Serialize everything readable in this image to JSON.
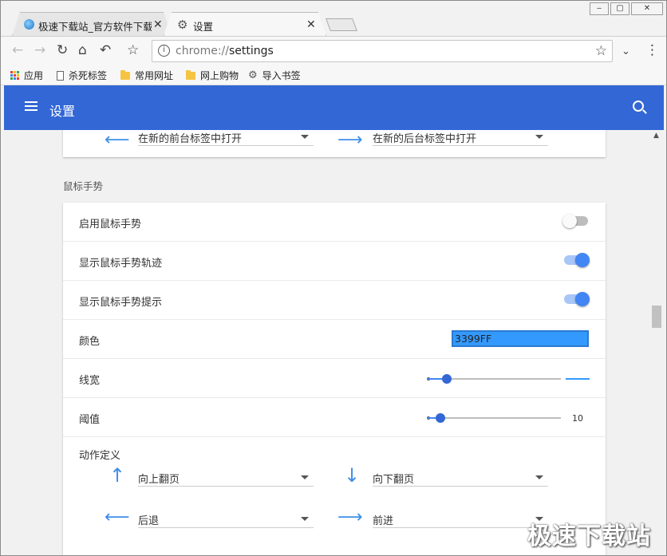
{
  "window": {
    "controls": [
      "‒",
      "▢",
      "✕"
    ]
  },
  "tabs": [
    {
      "label": "极速下载站_官方软件下载",
      "active": false
    },
    {
      "label": "设置",
      "active": true
    }
  ],
  "toolbar": {
    "url_scheme": "chrome://",
    "url_path": "settings"
  },
  "bookmarks": [
    {
      "label": "应用",
      "icon": "apps-grid-icon"
    },
    {
      "label": "杀死标签",
      "icon": "page-icon"
    },
    {
      "label": "常用网址",
      "icon": "folder-icon"
    },
    {
      "label": "网上购物",
      "icon": "folder-icon"
    },
    {
      "label": "导入书签",
      "icon": "gear-icon"
    }
  ],
  "header": {
    "title": "设置"
  },
  "top_card": {
    "left_action": "在新的前台标签中打开",
    "right_action": "在新的后台标签中打开"
  },
  "mouse_gesture": {
    "section_title": "鼠标手势",
    "enable_label": "启用鼠标手势",
    "enable_on": false,
    "show_trail_label": "显示鼠标手势轨迹",
    "show_trail_on": true,
    "show_hint_label": "显示鼠标手势提示",
    "show_hint_on": true,
    "color_label": "颜色",
    "color_value": "3399FF",
    "line_width_label": "线宽",
    "line_width_fraction": 0.15,
    "threshold_label": "阈值",
    "threshold_value": "10",
    "threshold_fraction": 0.1,
    "actions_label": "动作定义",
    "actions": {
      "up": "向上翻页",
      "down": "向下翻页",
      "left": "后退",
      "right": "前进"
    }
  },
  "watermark": "极速下载站",
  "colors": {
    "accent": "#3367d6",
    "toggle_on": "#4285f4",
    "arrow": "#3f8fe8",
    "color_field": "#3399ff"
  }
}
